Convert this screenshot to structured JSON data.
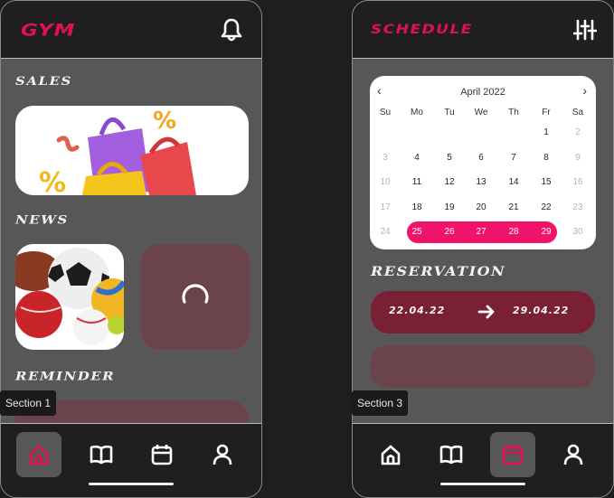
{
  "screen1": {
    "brand": "GYM",
    "sections": {
      "sales": "SALES",
      "news": "NEWS",
      "reminder": "REMINDER"
    },
    "tag": "Section 1",
    "nav": [
      "home-icon",
      "book-icon",
      "calendar-icon",
      "user-icon"
    ],
    "active_nav": "home"
  },
  "screen2": {
    "brand": "SCHEDULE",
    "calendar": {
      "month": "April 2022",
      "weekdays": [
        "Su",
        "Mo",
        "Tu",
        "We",
        "Th",
        "Fr",
        "Sa"
      ],
      "weeks": [
        [
          {
            "d": ""
          },
          {
            "d": ""
          },
          {
            "d": ""
          },
          {
            "d": ""
          },
          {
            "d": ""
          },
          {
            "d": "1"
          },
          {
            "d": "2",
            "muted": true
          }
        ],
        [
          {
            "d": "3",
            "muted": true
          },
          {
            "d": "4"
          },
          {
            "d": "5"
          },
          {
            "d": "6"
          },
          {
            "d": "7"
          },
          {
            "d": "8"
          },
          {
            "d": "9",
            "muted": true
          }
        ],
        [
          {
            "d": "10",
            "muted": true
          },
          {
            "d": "11"
          },
          {
            "d": "12"
          },
          {
            "d": "13"
          },
          {
            "d": "14"
          },
          {
            "d": "15"
          },
          {
            "d": "16",
            "muted": true
          }
        ],
        [
          {
            "d": "17",
            "muted": true
          },
          {
            "d": "18"
          },
          {
            "d": "19"
          },
          {
            "d": "20"
          },
          {
            "d": "21"
          },
          {
            "d": "22"
          },
          {
            "d": "23",
            "muted": true
          }
        ],
        [
          {
            "d": "24",
            "muted": true
          },
          {
            "d": "25",
            "sel": true
          },
          {
            "d": "26",
            "sel": true
          },
          {
            "d": "27",
            "sel": true
          },
          {
            "d": "28",
            "sel": true
          },
          {
            "d": "29",
            "sel": true
          },
          {
            "d": "30",
            "muted": true
          }
        ]
      ]
    },
    "reservation_title": "RESERVATION",
    "reservation": {
      "from": "22.04.22",
      "to": "29.04.22"
    },
    "tag": "Section 3",
    "nav": [
      "home-icon",
      "book-icon",
      "calendar-icon",
      "user-icon"
    ],
    "active_nav": "calendar"
  },
  "colors": {
    "brand": "#e0114d",
    "range": "#f0136a",
    "reservation": "#7a2035",
    "placeholder": "#6b434b"
  }
}
